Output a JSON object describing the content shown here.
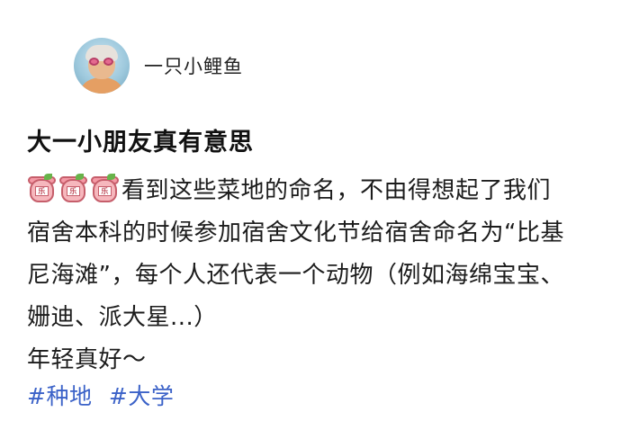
{
  "post": {
    "author": {
      "name": "一只小鲤鱼"
    },
    "title": "大一小朋友真有意思",
    "emojis": [
      {
        "icon": "fun-drink-emoji-icon",
        "label": "乐"
      },
      {
        "icon": "fun-drink-emoji-icon",
        "label": "乐"
      },
      {
        "icon": "fun-drink-emoji-icon",
        "label": "乐"
      }
    ],
    "body_lines": [
      "看到这些菜地的命名，不由得想起了我们",
      "宿舍本科的时候参加宿舍文化节给宿舍命名为“比基",
      "尼海滩”，每个人还代表一个动物（例如海绵宝宝、",
      "姗迪、派大星...）",
      "年轻真好～"
    ],
    "hashtags": [
      "#种地",
      "#大学"
    ]
  },
  "colors": {
    "hashtag": "#3b62c8",
    "text": "#1c1c1c"
  }
}
